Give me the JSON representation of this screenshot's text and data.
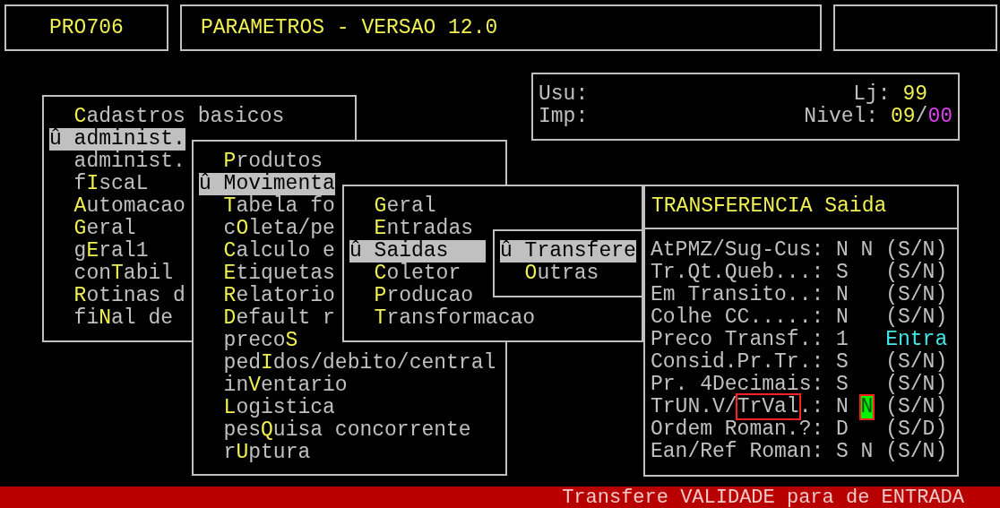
{
  "header": {
    "program": "PRO706",
    "title": "PARAMETROS - VERSAO 12.0"
  },
  "info": {
    "user_label": "Usu:",
    "printer_label": "Imp:",
    "store_label": "Lj:",
    "store": "99",
    "level_label": "Nivel:",
    "level_major": "09",
    "level_separator": "/",
    "level_minor": "00"
  },
  "menus": [
    {
      "items": [
        {
          "key": "C",
          "after": "adastros basicos",
          "selected": false
        },
        {
          "text": "û administ.",
          "selected": true
        },
        {
          "text": "administ.",
          "selected": false
        },
        {
          "before": "f",
          "key": "I",
          "after": "scaL",
          "selected": false
        },
        {
          "key": "A",
          "after": "utomacao",
          "selected": false
        },
        {
          "key": "G",
          "after": "eral",
          "selected": false
        },
        {
          "before": "g",
          "key": "E",
          "after": "ral1",
          "selected": false
        },
        {
          "before": "con",
          "key": "T",
          "after": "abil",
          "selected": false
        },
        {
          "key": "R",
          "after": "otinas d",
          "selected": false
        },
        {
          "before": "fi",
          "key": "N",
          "after": "al de",
          "selected": false
        }
      ]
    },
    {
      "items": [
        {
          "key": "P",
          "after": "rodutos",
          "selected": false
        },
        {
          "text": "û Movimenta",
          "selected": true
        },
        {
          "key": "T",
          "after": "abela fo",
          "selected": false
        },
        {
          "before": "c",
          "key": "O",
          "after": "leta/pe",
          "selected": false
        },
        {
          "key": "C",
          "after": "alculo e",
          "selected": false
        },
        {
          "key": "E",
          "after": "tiquetas",
          "selected": false
        },
        {
          "key": "R",
          "after": "elatorio",
          "selected": false
        },
        {
          "key": "D",
          "after": "efault r",
          "selected": false
        },
        {
          "before": "preco",
          "key": "S",
          "selected": false
        },
        {
          "before": "ped",
          "key": "I",
          "after": "dos/debito/central",
          "selected": false
        },
        {
          "before": "in",
          "key": "V",
          "after": "entario",
          "selected": false
        },
        {
          "key": "L",
          "after": "ogistica",
          "selected": false
        },
        {
          "before": "pes",
          "key": "Q",
          "after": "uisa concorrente",
          "selected": false
        },
        {
          "before": "r",
          "key": "U",
          "after": "ptura",
          "selected": false
        }
      ]
    },
    {
      "items": [
        {
          "key": "G",
          "after": "eral",
          "selected": false
        },
        {
          "key": "E",
          "after": "ntradas",
          "selected": false
        },
        {
          "text": "û Saidas",
          "selected": true
        },
        {
          "key": "C",
          "after": "oletor",
          "selected": false
        },
        {
          "key": "P",
          "after": "roducao",
          "selected": false
        },
        {
          "key": "T",
          "after": "ransformacao",
          "selected": false
        }
      ]
    },
    {
      "items": [
        {
          "text": "û Transfere",
          "selected": true
        },
        {
          "key": "O",
          "after": "utras",
          "selected": false
        }
      ]
    }
  ],
  "settings": {
    "title": "TRANSFERENCIA Saida",
    "rows": [
      {
        "label": [
          {
            "text": "AtPMZ/Sug-Cus:",
            "marked": false
          }
        ],
        "value": "N",
        "value_2": "N",
        "value_2_active": false,
        "hint": "(S/N)",
        "kind": "choices"
      },
      {
        "label": [
          {
            "text": "Tr.Qt.Queb...:",
            "marked": false
          }
        ],
        "value": "S",
        "hint": "(S/N)",
        "kind": "choices"
      },
      {
        "label": [
          {
            "text": "Em Transito..:",
            "marked": false
          }
        ],
        "value": "N",
        "hint": "(S/N)",
        "kind": "choices"
      },
      {
        "label": [
          {
            "text": "Colhe CC.....:",
            "marked": false
          }
        ],
        "value": "N",
        "hint": "(S/N)",
        "kind": "choices"
      },
      {
        "label": [
          {
            "text": "Preco Transf.:",
            "marked": false
          }
        ],
        "value": "1",
        "hint": "Entra",
        "kind": "option"
      },
      {
        "label": [
          {
            "text": "Consid.Pr.Tr.:",
            "marked": false
          }
        ],
        "value": "S",
        "hint": "(S/N)",
        "kind": "choices"
      },
      {
        "label": [
          {
            "text": "Pr. 4Decimais:",
            "marked": false
          }
        ],
        "value": "S",
        "hint": "(S/N)",
        "kind": "choices"
      },
      {
        "label": [
          {
            "text": "TrUN.V/",
            "marked": false
          },
          {
            "text": "TrVal",
            "marked": true
          },
          {
            "text": ".:",
            "marked": false
          }
        ],
        "value": "N",
        "value_2": "N",
        "value_2_active": true,
        "hint": "(S/N)",
        "kind": "choices"
      },
      {
        "label": [
          {
            "text": "Ordem Roman.?:",
            "marked": false
          }
        ],
        "value": "D",
        "hint": "(S/D)",
        "kind": "choices"
      },
      {
        "label": [
          {
            "text": "Ean/Ref Roman:",
            "marked": false
          }
        ],
        "value": "S",
        "value_2": "N",
        "value_2_active": false,
        "hint": "(S/N)",
        "kind": "choices"
      }
    ]
  },
  "status_bar": "Transfere VALIDADE para de ENTRADA"
}
